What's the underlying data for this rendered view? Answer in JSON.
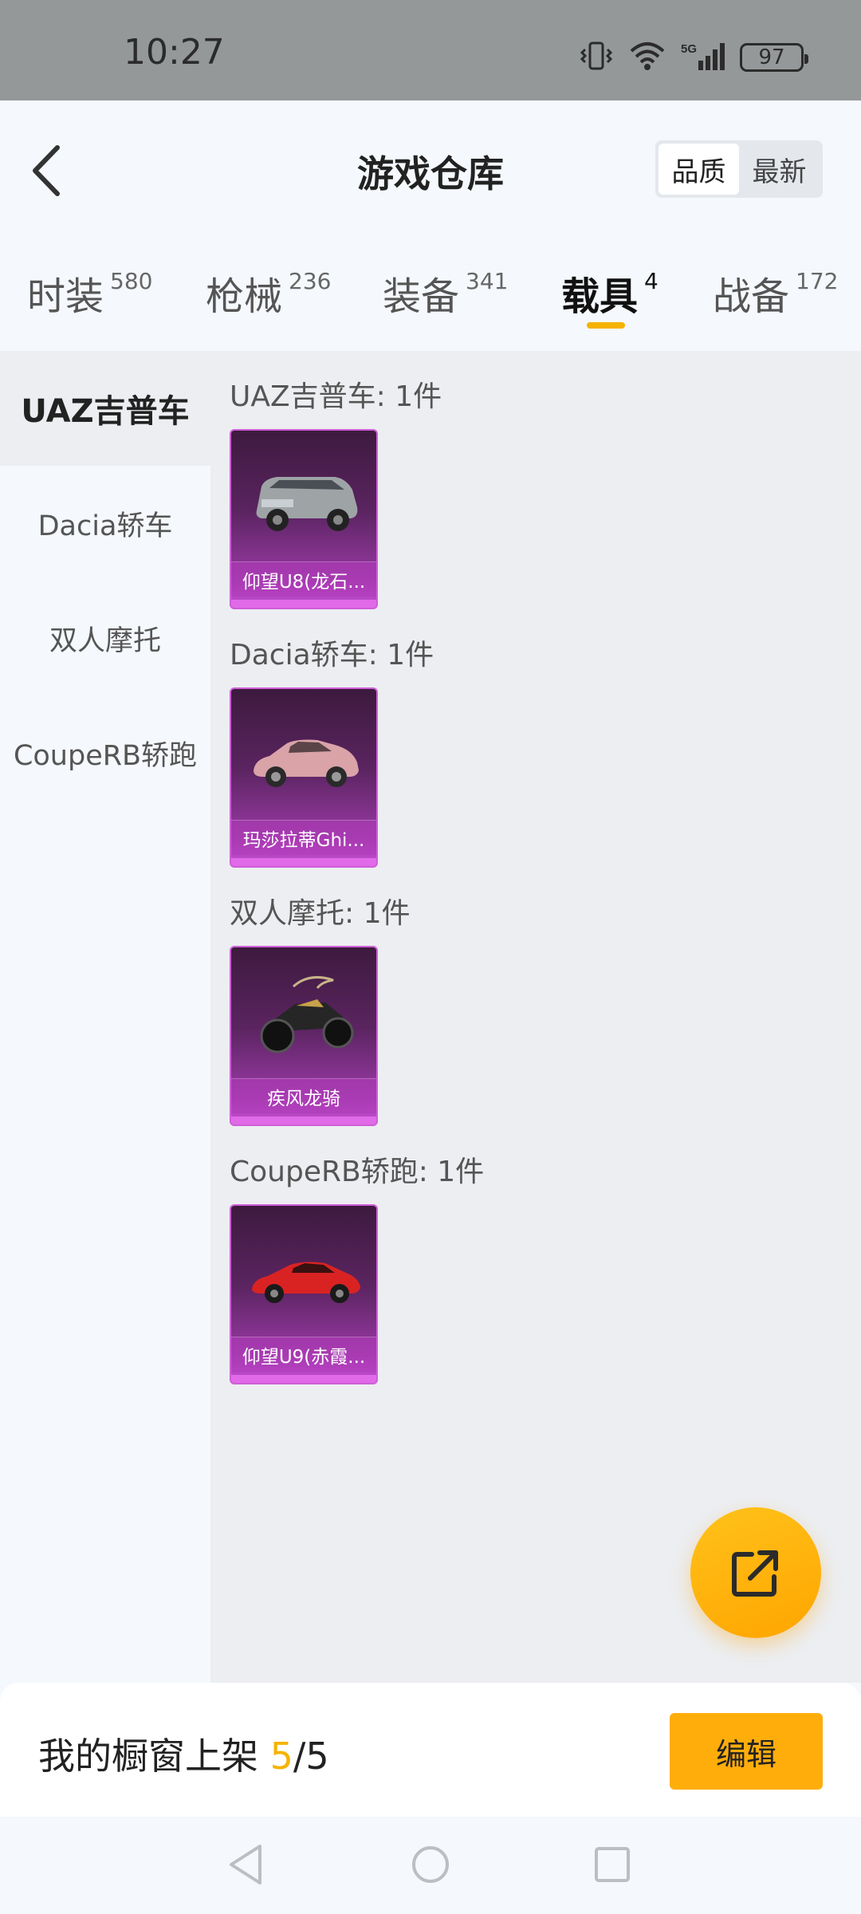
{
  "status_bar": {
    "time": "10:27",
    "battery": "97",
    "network": "5G",
    "icons": [
      "vibrate-icon",
      "wifi-icon",
      "signal-icon",
      "battery-icon"
    ]
  },
  "header": {
    "title": "游戏仓库",
    "sort_options": [
      {
        "label": "品质",
        "active": true
      },
      {
        "label": "最新",
        "active": false
      }
    ]
  },
  "tabs": [
    {
      "label": "时装",
      "count": "580"
    },
    {
      "label": "枪械",
      "count": "236"
    },
    {
      "label": "装备",
      "count": "341"
    },
    {
      "label": "载具",
      "count": "4",
      "active": true
    },
    {
      "label": "战备",
      "count": "172"
    }
  ],
  "sidebar": {
    "items": [
      {
        "label": "UAZ吉普车",
        "active": true
      },
      {
        "label": "Dacia轿车"
      },
      {
        "label": "双人摩托"
      },
      {
        "label": "CoupeRB轿跑"
      }
    ]
  },
  "groups": [
    {
      "title": "UAZ吉普车: 1件",
      "items": [
        {
          "name": "仰望U8(龙石...",
          "icon": "suv-car-icon"
        }
      ]
    },
    {
      "title": "Dacia轿车: 1件",
      "items": [
        {
          "name": "玛莎拉蒂Ghi...",
          "icon": "sedan-car-icon"
        }
      ]
    },
    {
      "title": "双人摩托: 1件",
      "items": [
        {
          "name": "疾风龙骑",
          "icon": "motorcycle-icon"
        }
      ]
    },
    {
      "title": "CoupeRB轿跑: 1件",
      "items": [
        {
          "name": "仰望U9(赤霞...",
          "icon": "sports-car-icon"
        }
      ]
    }
  ],
  "fab": {
    "icon": "share-icon"
  },
  "bottom": {
    "label": "我的橱窗上架 ",
    "current": "5",
    "separator": "/",
    "total": "5",
    "edit_label": "编辑"
  },
  "colors": {
    "accent": "#f5b300",
    "card_gradient_top": "#3d1a3e",
    "card_gradient_bottom": "#c74fd4",
    "fab": "#ffad0b"
  }
}
